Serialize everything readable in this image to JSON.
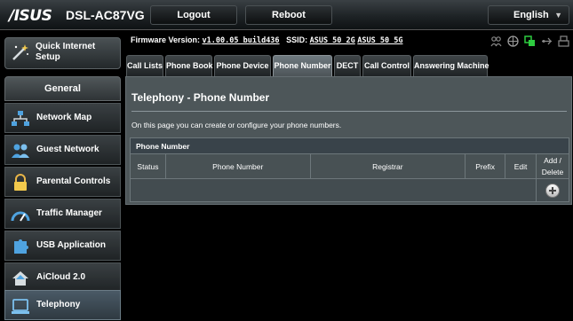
{
  "header": {
    "logo": "/ISUS",
    "model": "DSL-AC87VG",
    "logout_label": "Logout",
    "reboot_label": "Reboot",
    "language": "English"
  },
  "sidebar": {
    "quick_setup": "Quick Internet Setup",
    "general": "General",
    "items": [
      {
        "label": "Network Map",
        "icon": "network-map-icon"
      },
      {
        "label": "Guest Network",
        "icon": "guest-network-icon"
      },
      {
        "label": "Parental Controls",
        "icon": "parental-controls-icon"
      },
      {
        "label": "Traffic Manager",
        "icon": "traffic-manager-icon"
      },
      {
        "label": "USB Application",
        "icon": "usb-application-icon"
      },
      {
        "label": "AiCloud 2.0",
        "icon": "aicloud-icon"
      },
      {
        "label": "Telephony",
        "icon": "telephony-icon",
        "active": true
      }
    ]
  },
  "firmware": {
    "label": "Firmware Version:",
    "version": "v1.00.05_build436",
    "ssid_label": "SSID:",
    "ssid1": "ASUS_50_2G",
    "ssid2": "ASUS_50_5G"
  },
  "tabs": [
    {
      "label": "Call Lists"
    },
    {
      "label": "Phone Book"
    },
    {
      "label": "Phone Device"
    },
    {
      "label": "Phone Number",
      "active": true
    },
    {
      "label": "DECT"
    },
    {
      "label": "Call Control"
    },
    {
      "label": "Answering Machine"
    }
  ],
  "main": {
    "title": "Telephony - Phone Number",
    "description": "On this page you can create or configure your phone numbers.",
    "table": {
      "title": "Phone Number",
      "columns": [
        "Status",
        "Phone Number",
        "Registrar",
        "Prefix",
        "Edit",
        "Add / Delete"
      ]
    }
  },
  "colors": {
    "accent_green": "#2ecc40",
    "panel": "#4d5659"
  }
}
